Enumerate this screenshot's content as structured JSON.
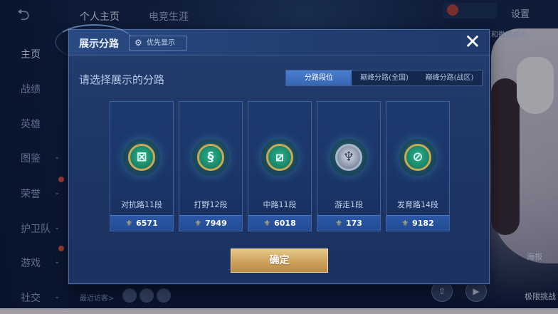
{
  "background": {
    "back_icon": "back-arrow-icon",
    "top_tabs": [
      {
        "label": "个人主页",
        "active": true
      },
      {
        "label": "电竞生涯",
        "active": false
      }
    ],
    "settings_label": "设置",
    "right_label": "主和徽章展示",
    "nav_items": [
      {
        "label": "主页",
        "active": true,
        "chevron": false,
        "dot": false
      },
      {
        "label": "战绩",
        "active": false,
        "chevron": false,
        "dot": false
      },
      {
        "label": "英雄",
        "active": false,
        "chevron": false,
        "dot": false
      },
      {
        "label": "图鉴",
        "active": false,
        "chevron": true,
        "dot": false
      },
      {
        "label": "荣誉",
        "active": false,
        "chevron": true,
        "dot": true
      },
      {
        "label": "护卫队",
        "active": false,
        "chevron": true,
        "dot": false
      },
      {
        "label": "游戏",
        "active": false,
        "chevron": true,
        "dot": true
      },
      {
        "label": "社交",
        "active": false,
        "chevron": true,
        "dot": false
      }
    ],
    "recent_visitors_label": "最近访客>",
    "char_label_1": "海报",
    "char_label_2": "极限挑战"
  },
  "modal": {
    "title": "展示分路",
    "priority_button": {
      "label": "优先显示",
      "icon": "gear-icon"
    },
    "close_icon": "close-icon",
    "subtitle": "请选择展示的分路",
    "tabs": [
      {
        "label": "分路段位",
        "active": true
      },
      {
        "label": "巅峰分路(全国)",
        "active": false
      },
      {
        "label": "巅峰分路(战区)",
        "active": false
      }
    ],
    "roles": [
      {
        "label": "对抗路11段",
        "score": "6571",
        "emblem": "clash-lane-emblem-icon",
        "glyph": "⊠",
        "style": "green"
      },
      {
        "label": "打野12段",
        "score": "7949",
        "emblem": "jungle-emblem-icon",
        "glyph": "§",
        "style": "green"
      },
      {
        "label": "中路11段",
        "score": "6018",
        "emblem": "mid-lane-emblem-icon",
        "glyph": "⧄",
        "style": "green"
      },
      {
        "label": "游走1段",
        "score": "173",
        "emblem": "roam-emblem-icon",
        "glyph": "♆",
        "style": "silver"
      },
      {
        "label": "发育路14段",
        "score": "9182",
        "emblem": "farm-lane-emblem-icon",
        "glyph": "⊘",
        "style": "green"
      }
    ],
    "confirm_label": "确定"
  },
  "colors": {
    "accent_blue": "#3666b3",
    "gold_button": "#cfa45f",
    "emblem_green": "#1a8a6c"
  }
}
